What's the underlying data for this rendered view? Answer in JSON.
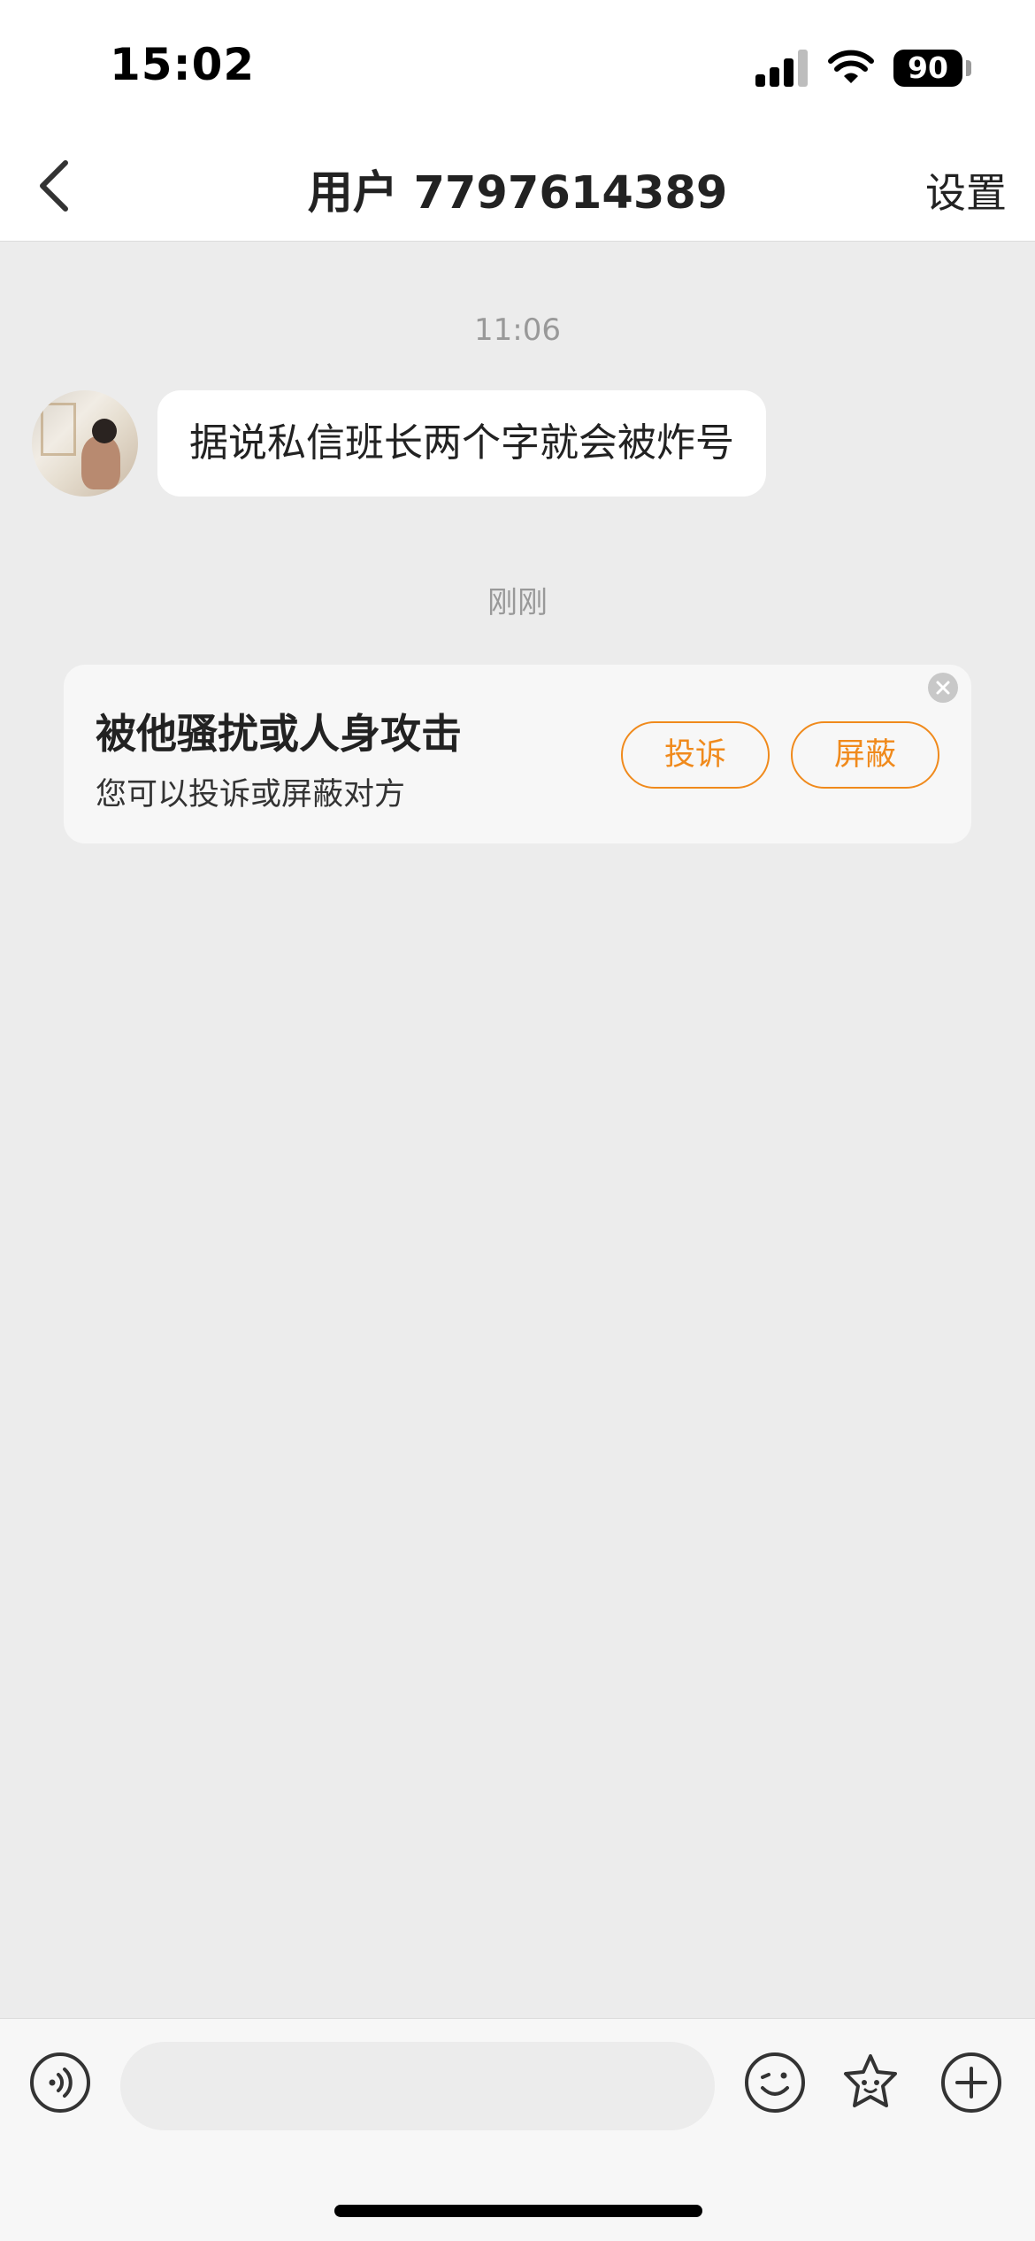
{
  "status_bar": {
    "time": "15:02",
    "battery": "90",
    "icons": [
      "signal-icon",
      "wifi-icon",
      "battery-icon"
    ]
  },
  "nav": {
    "title": "用户 7797614389",
    "settings_label": "设置",
    "back_icon": "chevron-left-icon"
  },
  "chat": {
    "timestamp_1": "11:06",
    "message_1": "据说私信班长两个字就会被炸号",
    "timestamp_2": "刚刚"
  },
  "warning_card": {
    "title": "被他骚扰或人身攻击",
    "subtitle": "您可以投诉或屏蔽对方",
    "report_label": "投诉",
    "block_label": "屏蔽",
    "close_icon": "close-circle-icon"
  },
  "input_bar": {
    "placeholder": "",
    "icons": [
      "voice-icon",
      "emoji-icon",
      "sticker-icon",
      "plus-icon"
    ]
  },
  "colors": {
    "accent": "#f08a1c",
    "background": "#ececec",
    "bubble": "#ffffff"
  }
}
